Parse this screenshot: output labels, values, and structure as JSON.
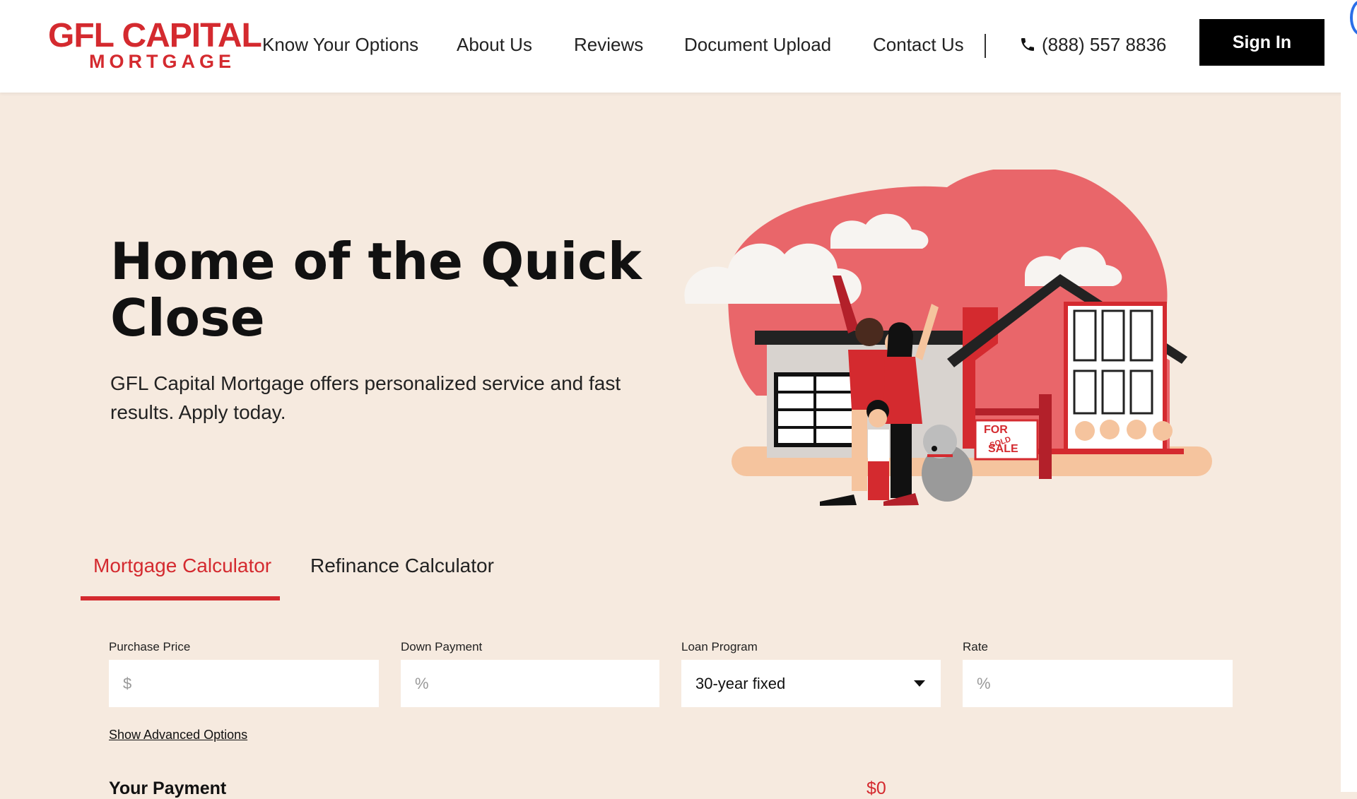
{
  "brand": {
    "name_line1": "GFL CAPITAL",
    "name_line2": "MORTGAGE",
    "color": "#d42a2f"
  },
  "nav": {
    "items": [
      {
        "label": "Know Your Options"
      },
      {
        "label": "About Us"
      },
      {
        "label": "Reviews"
      },
      {
        "label": "Document Upload"
      },
      {
        "label": "Contact Us"
      }
    ],
    "phone": "(888) 557 8836",
    "phone_icon": "phone-icon",
    "sign_in": "Sign In"
  },
  "hero": {
    "title": "Home of the Quick Close",
    "subtitle": "GFL Capital Mortgage offers personalized service and fast results. Apply today.",
    "sign_text_1": "FOR",
    "sign_text_2": "SALE",
    "sign_sticker": "SOLD"
  },
  "calculator": {
    "tabs": [
      {
        "label": "Mortgage Calculator",
        "active": true
      },
      {
        "label": "Refinance Calculator",
        "active": false
      }
    ],
    "fields": {
      "purchase_price": {
        "label": "Purchase Price",
        "placeholder": "$",
        "value": ""
      },
      "down_payment": {
        "label": "Down Payment",
        "placeholder": "%",
        "value": ""
      },
      "loan_program": {
        "label": "Loan Program",
        "value": "30-year fixed"
      },
      "rate": {
        "label": "Rate",
        "placeholder": "%",
        "value": ""
      }
    },
    "advanced_link": "Show Advanced Options",
    "payment_label": "Your Payment",
    "payment_value": "$0"
  },
  "colors": {
    "page_bg": "#f6eadf",
    "accent": "#d42a2f",
    "header_bg": "#ffffff",
    "button_bg": "#000000"
  }
}
